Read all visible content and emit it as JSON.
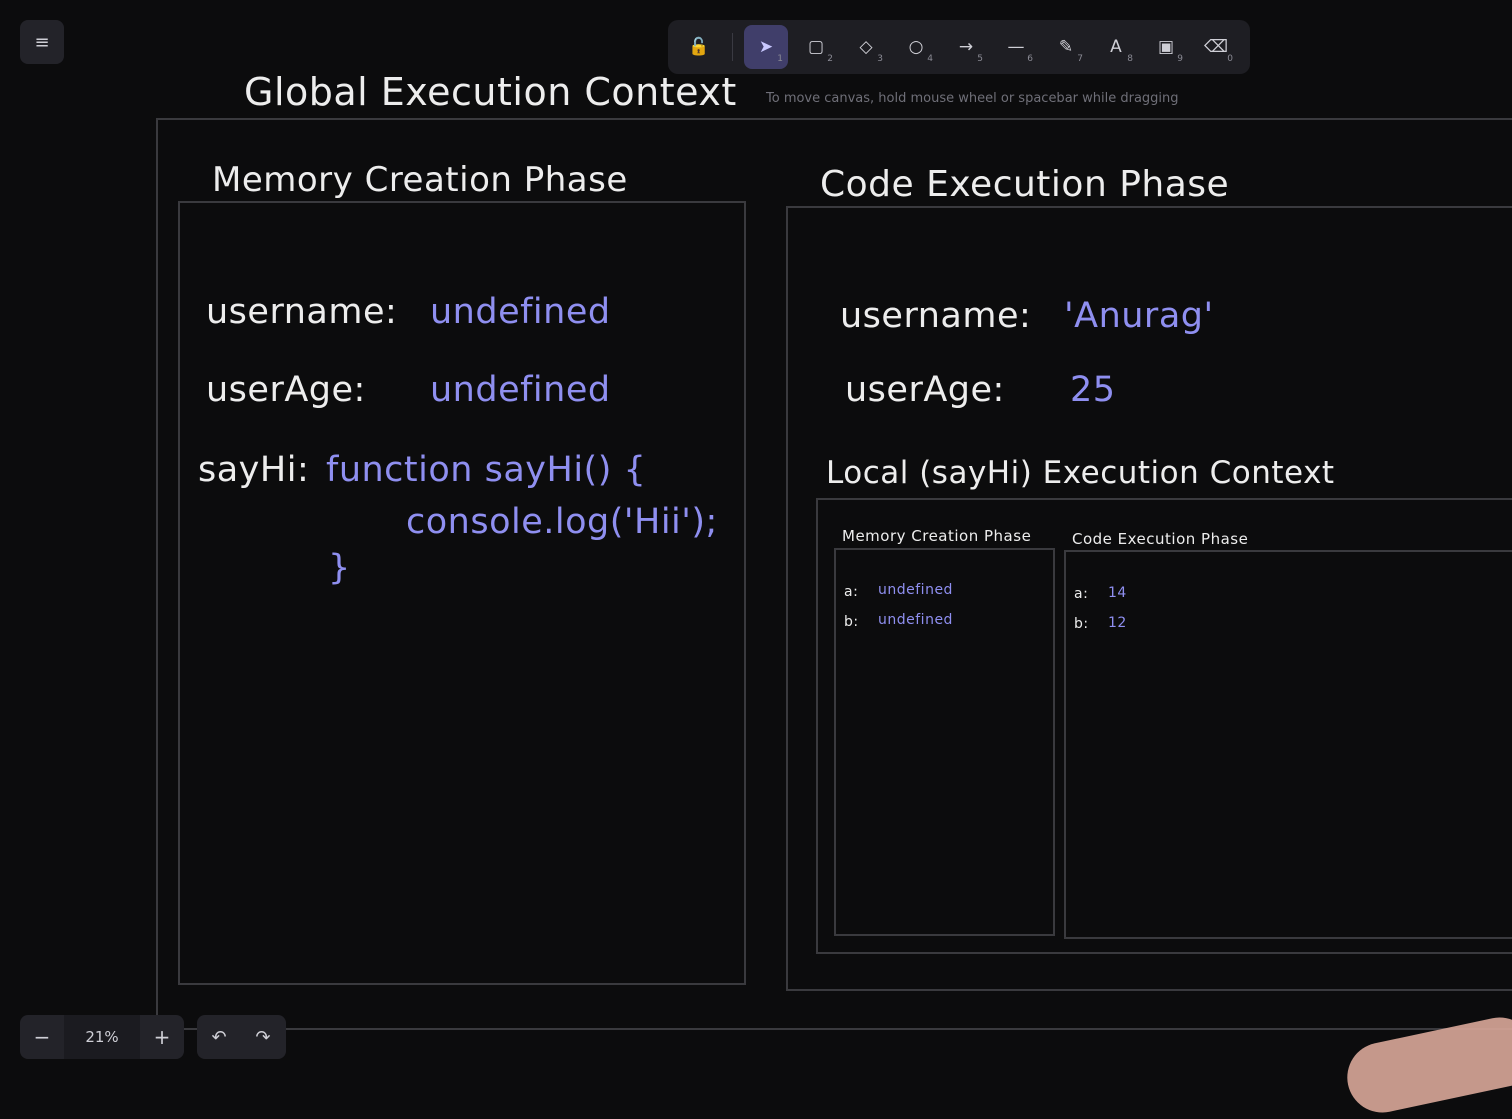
{
  "toolbar": {
    "tools": [
      {
        "name": "lock",
        "icon": "lock-icon",
        "glyph": "🔓",
        "num": ""
      },
      {
        "name": "selection",
        "icon": "pointer-icon",
        "glyph": "➤",
        "num": "1"
      },
      {
        "name": "rectangle",
        "icon": "rectangle-icon",
        "glyph": "▢",
        "num": "2"
      },
      {
        "name": "diamond",
        "icon": "diamond-icon",
        "glyph": "◇",
        "num": "3"
      },
      {
        "name": "ellipse",
        "icon": "circle-icon",
        "glyph": "○",
        "num": "4"
      },
      {
        "name": "arrow",
        "icon": "arrow-icon",
        "glyph": "→",
        "num": "5"
      },
      {
        "name": "line",
        "icon": "line-icon",
        "glyph": "—",
        "num": "6"
      },
      {
        "name": "draw",
        "icon": "pencil-icon",
        "glyph": "✎",
        "num": "7"
      },
      {
        "name": "text",
        "icon": "text-icon",
        "glyph": "A",
        "num": "8"
      },
      {
        "name": "image",
        "icon": "image-icon",
        "glyph": "▣",
        "num": "9"
      },
      {
        "name": "eraser",
        "icon": "eraser-icon",
        "glyph": "⌫",
        "num": "0"
      }
    ],
    "hint": "To move canvas, hold mouse wheel or spacebar while dragging"
  },
  "menu": {
    "glyph": "≡"
  },
  "canvas": {
    "global_title": "Global Execution Context",
    "memory_title": "Memory Creation Phase",
    "code_title": "Code Execution Phase",
    "memory": {
      "username_label": "username:",
      "username_value": "undefined",
      "userage_label": "userAge:",
      "userage_value": "undefined",
      "sayhi_label": "sayHi:",
      "sayhi_line1": "function sayHi() {",
      "sayhi_line2": "console.log('Hii');",
      "sayhi_line3": "}"
    },
    "code": {
      "username_label": "username:",
      "username_value": "'Anurag'",
      "userage_label": "userAge:",
      "userage_value": "25"
    },
    "local": {
      "title": "Local (sayHi) Execution Context",
      "memory_title": "Memory Creation Phase",
      "code_title": "Code Execution Phase",
      "memory": {
        "a_label": "a:",
        "a_value": "undefined",
        "b_label": "b:",
        "b_value": "undefined"
      },
      "code": {
        "a_label": "a:",
        "a_value": "14",
        "b_label": "b:",
        "b_value": "12"
      }
    }
  },
  "zoom": {
    "minus": "−",
    "value": "21%",
    "plus": "+"
  },
  "history": {
    "undo": "↶",
    "redo": "↷"
  }
}
